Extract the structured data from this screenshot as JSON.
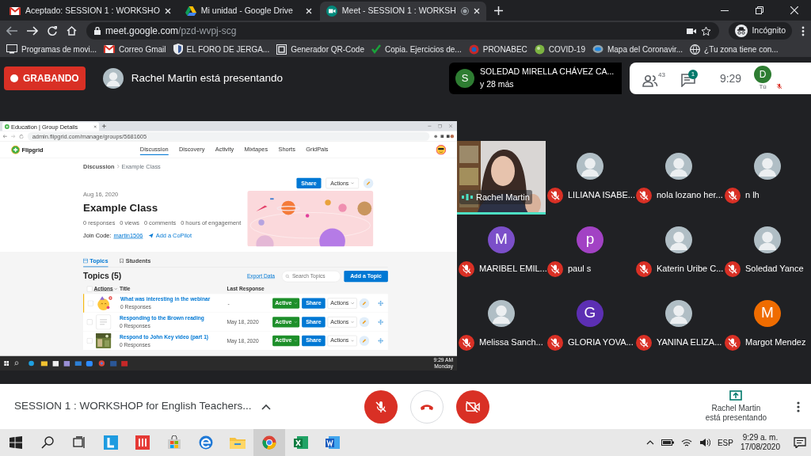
{
  "browser": {
    "tabs": [
      {
        "title": "Aceptado: SESSION 1 : WORKSHO",
        "kind": "mail",
        "selected": false
      },
      {
        "title": "Mi unidad - Google Drive",
        "kind": "drive",
        "selected": false
      },
      {
        "title": "Meet - SESSION 1 : WORKSH",
        "kind": "meet",
        "selected": true
      }
    ],
    "address": {
      "host": "meet.google.com",
      "path": "/pzd-wvpj-scg"
    },
    "profile": "Incógnito",
    "bookmarks": [
      {
        "label": "Programas de movi...",
        "kind": "screen"
      },
      {
        "label": "Correo Gmail",
        "kind": "mail"
      },
      {
        "label": "EL FORO DE JERGA...",
        "kind": "shield"
      },
      {
        "label": "Generador QR-Code",
        "kind": "qr"
      },
      {
        "label": "Copia. Ejercicios de...",
        "kind": "check"
      },
      {
        "label": "PRONABEC",
        "kind": "badge"
      },
      {
        "label": "COVID-19",
        "kind": "ball"
      },
      {
        "label": "Mapa del Coronavir...",
        "kind": "oval"
      },
      {
        "label": "¿Tu zona tiene con...",
        "kind": "globe"
      }
    ]
  },
  "meet": {
    "recording": "GRABANDO",
    "presenter": "Rachel Martin está presentando",
    "speaker": {
      "initial": "S",
      "name": "SOLEDAD MIRELLA CHÁVEZ CA...",
      "others": "y 28 más"
    },
    "people_count": "43",
    "chat_count": "1",
    "clock": "9:29",
    "self": {
      "initial": "D",
      "label": "Tú",
      "muted": true
    },
    "shared_screen": {
      "tab_title": "Education | Group Details",
      "url": "admin.flipgrid.com/manage/groups/5681605",
      "brand": "Flipgrid",
      "nav": [
        {
          "label": "Discussion",
          "selected": true
        },
        {
          "label": "Discovery",
          "selected": false
        },
        {
          "label": "Activity",
          "selected": false
        },
        {
          "label": "Mixtapes",
          "selected": false
        },
        {
          "label": "Shorts",
          "selected": false
        },
        {
          "label": "GridPals",
          "selected": false
        }
      ],
      "breadcrumb": [
        "Discussion",
        "Example Class"
      ],
      "date": "Aug 16, 2020",
      "title": "Example Class",
      "stats": [
        "0 responses",
        "0 views",
        "0 comments",
        "0 hours of engagement"
      ],
      "join_label": "Join Code:",
      "join_code": "martin1506",
      "copilot": "Add a CoPilot",
      "share": "Share",
      "actions": "Actions",
      "tabs": [
        {
          "label": "Topics",
          "selected": true
        },
        {
          "label": "Students",
          "selected": false
        }
      ],
      "topics_title": "Topics (5)",
      "export": "Export Data",
      "search_placeholder": "Search Topics",
      "add_topic": "Add a Topic",
      "select_all_checked": false,
      "columns": [
        "Actions",
        "Title",
        "Last Response"
      ],
      "topics": [
        {
          "kind": "emoji",
          "checked": false,
          "title": "What was interesting in the webinar",
          "responses": "0 Responses",
          "last_response": "-",
          "status": "Active",
          "share": "Share",
          "actions": "Actions"
        },
        {
          "kind": "document",
          "checked": false,
          "title": "Responding to the Brown reading",
          "responses": "0 Responses",
          "last_response": "May 18, 2020",
          "status": "Active",
          "share": "Share",
          "actions": "Actions"
        },
        {
          "checked": false,
          "title": "Respond to John Key video (part 1)",
          "responses": "0 Responses",
          "last_response": "May 18, 2020",
          "status": "Active",
          "share": "Share",
          "actions": "Actions"
        }
      ],
      "clock": "9:29 AM",
      "day": "Monday"
    },
    "tiles": [
      {
        "kind": "video",
        "name": "Rachel Martin",
        "muted": false
      },
      {
        "name": "LILIANA ISABE...",
        "muted": true
      },
      {
        "name": "nola lozano her...",
        "muted": true
      },
      {
        "name": "n lh",
        "muted": true
      },
      {
        "kind": "initial",
        "initial": "M",
        "color": "#7b4fc9",
        "name": "MARIBEL EMIL...",
        "muted": true
      },
      {
        "kind": "initial",
        "initial": "p",
        "color": "#a242c4",
        "name": "paul s",
        "muted": true
      },
      {
        "name": "Katerin Uribe C...",
        "muted": true
      },
      {
        "name": "Soledad Yance",
        "muted": true
      },
      {
        "name": "Melissa Sanch...",
        "muted": true
      },
      {
        "kind": "initial",
        "initial": "G",
        "color": "#5c2fb3",
        "name": "GLORIA YOVA...",
        "muted": true
      },
      {
        "name": "YANINA ELIZA...",
        "muted": true
      },
      {
        "kind": "initial",
        "initial": "M",
        "color": "#ef6c00",
        "name": "Margot Mendez",
        "muted": true
      }
    ],
    "bottom": {
      "title": "SESSION 1 : WORKSHOP for English Teachers...",
      "mic_muted": true,
      "camera_off": true,
      "presenting_name": "Rachel Martin",
      "presenting_status": "está presentando"
    }
  },
  "taskbar": {
    "apps": [
      {
        "kind": "start",
        "selected": false
      },
      {
        "kind": "search",
        "selected": false
      },
      {
        "kind": "taskview",
        "selected": false
      },
      {
        "kind": "tile",
        "selected": false
      },
      {
        "kind": "redtile",
        "selected": false
      },
      {
        "kind": "store",
        "selected": false
      },
      {
        "kind": "edge",
        "selected": false
      },
      {
        "kind": "folder",
        "selected": false
      },
      {
        "kind": "chrome",
        "selected": true
      },
      {
        "kind": "sheet",
        "selected": false
      },
      {
        "kind": "doc",
        "selected": false
      }
    ],
    "language": "ESP",
    "time": "9:29 a. m.",
    "date": "17/08/2020"
  }
}
